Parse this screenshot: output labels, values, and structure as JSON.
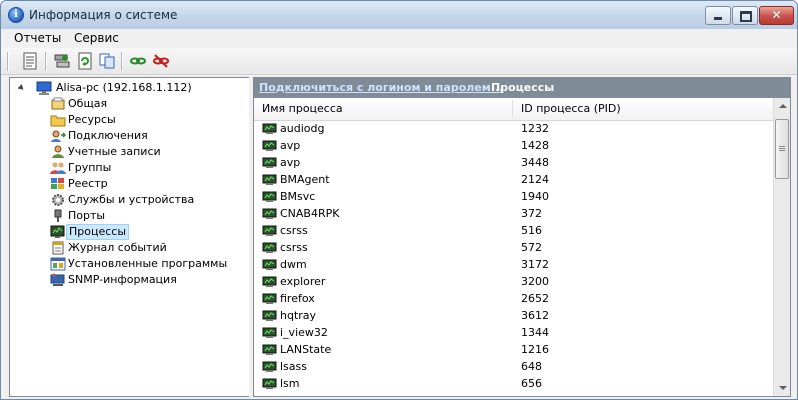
{
  "window": {
    "title": "Информация о системе"
  },
  "menu": [
    "Отчеты",
    "Сервис"
  ],
  "toolbar": {
    "buttons": [
      "report-icon",
      "network-scan-icon",
      "refresh-icon",
      "copy-icon",
      "connect-icon",
      "disconnect-icon"
    ]
  },
  "tree": {
    "root_label": "Alisa-pc (192.168.1.112)",
    "items": [
      {
        "label": "Общая",
        "icon": "general-info-icon"
      },
      {
        "label": "Ресурсы",
        "icon": "resources-folder-icon"
      },
      {
        "label": "Подключения",
        "icon": "connections-icon"
      },
      {
        "label": "Учетные записи",
        "icon": "user-accounts-icon"
      },
      {
        "label": "Группы",
        "icon": "groups-icon"
      },
      {
        "label": "Реестр",
        "icon": "registry-icon"
      },
      {
        "label": "Службы и устройства",
        "icon": "services-gear-icon"
      },
      {
        "label": "Порты",
        "icon": "ports-icon"
      },
      {
        "label": "Процессы",
        "icon": "processes-icon",
        "selected": true
      },
      {
        "label": "Журнал событий",
        "icon": "event-log-icon"
      },
      {
        "label": "Установленные программы",
        "icon": "installed-programs-icon"
      },
      {
        "label": "SNMP-информация",
        "icon": "snmp-icon"
      }
    ]
  },
  "panel": {
    "connect_link": "Подключиться с логином и паролем...",
    "title": "Процессы"
  },
  "table": {
    "columns": [
      "Имя процесса",
      "ID процесса (PID)"
    ],
    "rows": [
      {
        "name": "audiodg",
        "pid": "1232"
      },
      {
        "name": "avp",
        "pid": "1428"
      },
      {
        "name": "avp",
        "pid": "3448"
      },
      {
        "name": "BMAgent",
        "pid": "2124"
      },
      {
        "name": "BMsvc",
        "pid": "1940"
      },
      {
        "name": "CNAB4RPK",
        "pid": "372"
      },
      {
        "name": "csrss",
        "pid": "516"
      },
      {
        "name": "csrss",
        "pid": "572"
      },
      {
        "name": "dwm",
        "pid": "3172"
      },
      {
        "name": "explorer",
        "pid": "3200"
      },
      {
        "name": "firefox",
        "pid": "2652"
      },
      {
        "name": "hqtray",
        "pid": "3612"
      },
      {
        "name": "i_view32",
        "pid": "1344"
      },
      {
        "name": "LANState",
        "pid": "1216"
      },
      {
        "name": "lsass",
        "pid": "648"
      },
      {
        "name": "lsm",
        "pid": "656"
      }
    ]
  }
}
